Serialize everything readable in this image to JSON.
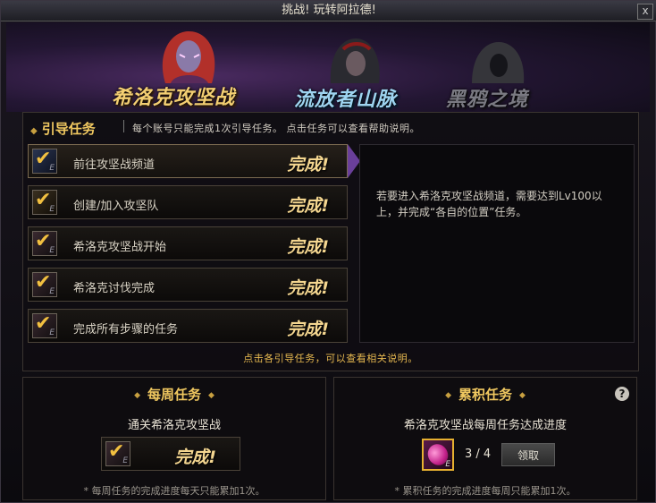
{
  "window": {
    "title": "挑战! 玩转阿拉德!",
    "close_label": "x"
  },
  "dungeon_tabs": [
    {
      "label": "希洛克攻坚战"
    },
    {
      "label": "流放者山脉"
    },
    {
      "label": "黑鸦之境"
    }
  ],
  "guide": {
    "heading": "引导任务",
    "note": "每个账号只能完成1次引导任务。 点击任务可以查看帮助说明。",
    "tasks": [
      {
        "label": "前往攻坚战频道",
        "status": "完成!"
      },
      {
        "label": "创建/加入攻坚队",
        "status": "完成!"
      },
      {
        "label": "希洛克攻坚战开始",
        "status": "完成!"
      },
      {
        "label": "希洛克讨伐完成",
        "status": "完成!"
      },
      {
        "label": "完成所有步骤的任务",
        "status": "完成!"
      }
    ],
    "description": "若要进入希洛克攻坚战频道，需要达到Lv100以上，并完成“各自的位置”任务。",
    "footer": "点击各引导任务，可以查看相关说明。"
  },
  "weekly": {
    "title": "每周任务",
    "subtitle": "通关希洛克攻坚战",
    "status": "完成!",
    "footer": "* 每周任务的完成进度每天只能累加1次。"
  },
  "accumulate": {
    "title": "累积任务",
    "subtitle": "希洛克攻坚战每周任务达成进度",
    "progress": "3 / 4",
    "claim_label": "领取",
    "help_label": "?",
    "footer": "* 累积任务的完成进度每周只能累加1次。"
  },
  "icons": {
    "check": "✔",
    "equip_mark": "E",
    "diamond": "◆"
  },
  "colors": {
    "gold": "#f0c860",
    "done_text": "#f4d690",
    "tab_selected": "#f4cf72",
    "tab_blue": "#9ed4f0",
    "tab_disabled": "#7a7a82"
  }
}
